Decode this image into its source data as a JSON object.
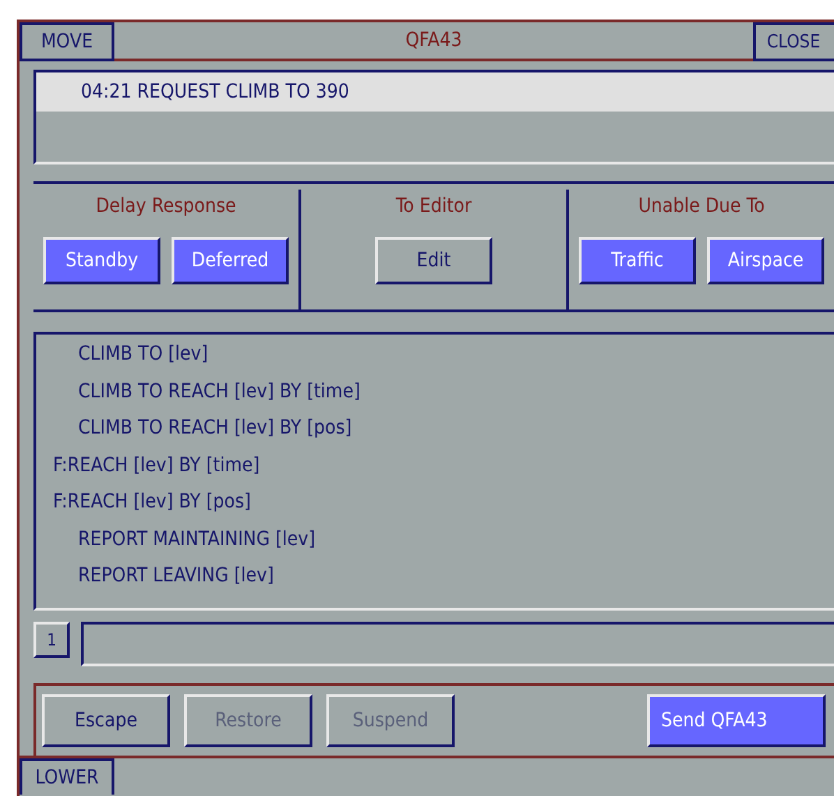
{
  "window": {
    "title": "QFA43",
    "move_button": "MOVE",
    "close_button": "CLOSE"
  },
  "messages": [
    {
      "text": "04:21 REQUEST CLIMB TO 390",
      "selected": true
    }
  ],
  "groups": [
    {
      "label": "Delay Response",
      "buttons": [
        {
          "label": "Standby",
          "kind": "highlight"
        },
        {
          "label": "Deferred",
          "kind": "highlight"
        }
      ]
    },
    {
      "label": "To Editor",
      "buttons": [
        {
          "label": "Edit",
          "kind": "normal"
        }
      ]
    },
    {
      "label": "Unable Due To",
      "buttons": [
        {
          "label": "Traffic",
          "kind": "highlight"
        },
        {
          "label": "Airspace",
          "kind": "highlight"
        }
      ]
    }
  ],
  "responses": [
    {
      "text": "CLIMB TO [lev]",
      "indented": true
    },
    {
      "text": "CLIMB TO REACH [lev] BY [time]",
      "indented": true
    },
    {
      "text": "CLIMB TO REACH [lev] BY [pos]",
      "indented": true
    },
    {
      "text": "F:REACH [lev] BY [time]",
      "indented": false
    },
    {
      "text": "F:REACH [lev] BY [pos]",
      "indented": false
    },
    {
      "text": "REPORT MAINTAINING [lev]",
      "indented": true
    },
    {
      "text": "REPORT LEAVING [lev]",
      "indented": true
    }
  ],
  "input": {
    "page_button": "1"
  },
  "actions": [
    {
      "label": "Escape",
      "kind": "normal"
    },
    {
      "label": "Restore",
      "kind": "disabled"
    },
    {
      "label": "Suspend",
      "kind": "disabled"
    },
    {
      "label": "Send QFA43",
      "kind": "highlight"
    }
  ],
  "footer": {
    "lower_button": "LOWER"
  }
}
